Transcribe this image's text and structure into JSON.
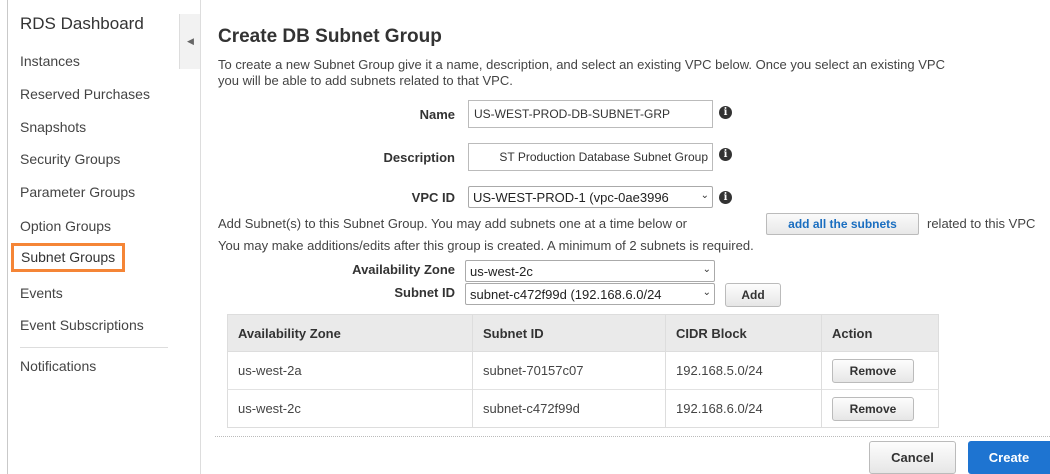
{
  "sidebar": {
    "title": "RDS Dashboard",
    "items": [
      {
        "label": "Instances"
      },
      {
        "label": "Reserved Purchases"
      },
      {
        "label": "Snapshots"
      },
      {
        "label": "Security Groups"
      },
      {
        "label": "Parameter Groups"
      },
      {
        "label": "Option Groups"
      },
      {
        "label": "Subnet Groups",
        "active": true
      },
      {
        "label": "Events"
      },
      {
        "label": "Event Subscriptions"
      },
      {
        "label": "Notifications"
      }
    ],
    "collapse_icon": "chevron-left-icon"
  },
  "main": {
    "title": "Create DB Subnet Group",
    "intro_line1": "To create a new Subnet Group give it a name, description, and select an existing VPC below. Once you select an existing VPC",
    "intro_line2": "you will be able to add subnets related to that VPC.",
    "name_label": "Name",
    "name_value": "US-WEST-PROD-DB-SUBNET-GRP",
    "description_label": "Description",
    "description_value": "ST Production Database Subnet Group",
    "vpc_label": "VPC ID",
    "vpc_value": "US-WEST-PROD-1 (vpc-0ae3996",
    "add_subnet_text": "Add Subnet(s) to this Subnet Group. You may add subnets one at a time below or",
    "add_all_label": "add all the subnets",
    "add_subnet_text_after": "related to this VPC",
    "note": "You may make additions/edits after this group is created. A minimum of 2 subnets is required.",
    "az_label": "Availability Zone",
    "az_value": "us-west-2c",
    "subnet_label": "Subnet ID",
    "subnet_value": "subnet-c472f99d (192.168.6.0/24",
    "add_label": "Add",
    "info_icon": "info-icon"
  },
  "table": {
    "headers": [
      "Availability Zone",
      "Subnet ID",
      "CIDR Block",
      "Action"
    ],
    "rows": [
      {
        "az": "us-west-2a",
        "subnet": "subnet-70157c07",
        "cidr": "192.168.5.0/24",
        "action": "Remove"
      },
      {
        "az": "us-west-2c",
        "subnet": "subnet-c472f99d",
        "cidr": "192.168.6.0/24",
        "action": "Remove"
      }
    ]
  },
  "footer": {
    "cancel_label": "Cancel",
    "create_label": "Create"
  },
  "colors": {
    "active_outline": "#f58536",
    "primary_button": "#1e74d1",
    "link_text": "#1a6ec0"
  }
}
